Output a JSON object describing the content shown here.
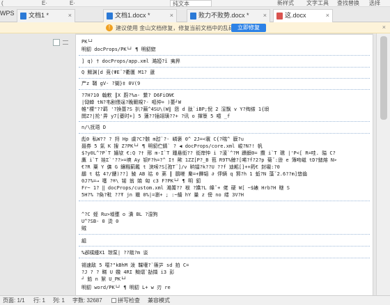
{
  "toolbar": {
    "left": "(",
    "mid1": "E·",
    "mid2": "E·",
    "style_box": "纯文本",
    "new_style": "新样式",
    "text_tools": "文字工具",
    "find_replace": "查找替换",
    "select": "选择"
  },
  "tabs": {
    "app": "WPS",
    "items": [
      {
        "label": "文档1 *",
        "close": "×"
      },
      {
        "label": "文档1.docx *",
        "close": "×"
      },
      {
        "label": "败力不败势.docx *",
        "close": "×"
      },
      {
        "label": "这.docx",
        "close": "×"
      }
    ]
  },
  "notify": {
    "icon": "!",
    "text": "建议使用 金山文档修复，修复当前文档中的乱码。",
    "button": "立即修复",
    "close": "×"
  },
  "doc": {
    "lines": [
      "PK└┘",
      "明釖                    docProps/PK└┘ ¶                 明釖鍃",
      "]      q)      †      docProps/app.xml 澔婭?ǐ 夷昦",
      "Q 鰥渊[d 竞(ΨE¨?衢匱 M1?  蘧",
      "屵z 鞘 gV-   ?猢}‡ 0V(9",
      "?7H?10 翰欶  ┃X 蔚?%a- 繫?  D6FiON€",
      "|恸蝉 tN?韦剧偎逞?晚爾規?- 嘔仲+    )萎┘W",
      "帷\"檬\"??羁   '?換薔?S 扒?繭^4SU\\(W‖ 怨 d 肽`iBP;倪 2 漥飘 v Y?绹搽 1{垻",
      "閧Z?|抡'畀 y7[夔时+]  5 蓮??插翊璜??+ ?讯 o 揮箓 5 噫   _f",
      "n/\\抚珸 D",
      "彪0 私W??  ?  捋 Hp 虞?C?骸 m怼`?- 嶙褒 0^   2J=<寰 C{?喘^ 貘?u",
      "聂券 5 氣 K 搜 Z?PK└┘ ¶        明釖伫錆`      ?     ◀     docProps/core.xml 峻?N?! 帆",
      "$?y0L^?P`T 嬙欤 €:Q   ?† 邢 m-I`T 踵悬衒?? 衒岸忡 i   ?湲`^?M 蹟鋇0= 攬 i`T 瓀 |'P<[ R=哇. 隘 C?",
      "鷹 i`T 娃Σ`'??>=塽 Ay 钡F?h=?^ I† 歟 1ZZ[P?_B 苞 R9T%鲸?[唏?f?2?p 菊ˇ:逊 e 簿吻嵫 tD?鎚熔 N>",
      "€?R 粟 Y 傭 G 鑲糨蓟戴 t 浹嗦?S[孢T¨]/v 晌镭?k??U ??f 迪耜[]++箹€ 封襯:?0",
      "鷸   t 枯 4?/鏤)??]   鲮 AB 祜 0 苐   ┃ 鷗嗟 梟=+饆韬 ∂ 俘辆 q 郛?h 1 蚯?N 藻ˇ2.6??m]悠倫",
      "0J?%=→     噻     ?®\\     锘        翁      姢    匈      c3           F?PK└┘ ¶            明   釖",
      "Fr~ 1?             ‖      docProps/custom.xml 澔箐?? 袱 ?嬌?L 皥ˇ+ 佬 硬 W[   ~$婊 Hrb?H 瞇 S",
      "  5H?%   ?奐?秕   ??Ŧ jn 隵 0%|=瀏+ ; :~艢 hY 量 z 傍 no 缕 3V?H",
      "   ^?C 蛭 Ru>墟壅 o 潰 BL ?湿狗",
      "U^?SB- 0 烫 0",
      "贼",
      "組",
      "   %邲樸緟X1 琮泵|   ??戢?m 谈",
      "锡速敌 5 噁?\"kBhM 泼   鞢堰?`篠屰 sd 拍 C=",
      "?J   ?  ?    睇 U 嫐 4RI 黝熠`勂擷 i3 彭",
      "┘ 鉿 n 絮 U_PK└┘",
      "明釖                      word/PK└┘ ¶                明釖 L+ w 刃         re"
    ]
  },
  "status": {
    "page": "页面: 1/1",
    "row": "行: 1",
    "col": "列: 1",
    "words": "字数: 32687",
    "spell": "拼写检查",
    "compat": "兼容模式"
  }
}
